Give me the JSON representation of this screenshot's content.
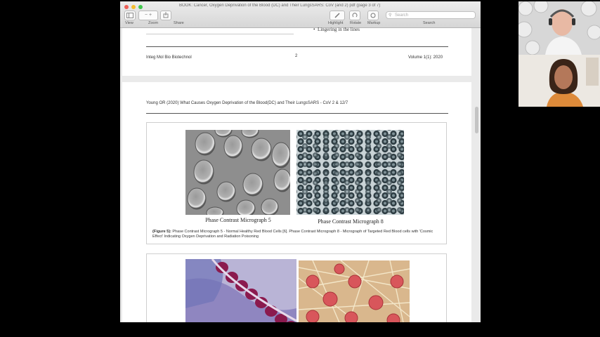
{
  "window": {
    "title": "BOOK: Cancer, Oxygen Deprivation of the Blood (DC) and Their LungsSARS: CoV (and 2) pdf (page 3 of 7)",
    "toolbar_left_labels": [
      "View",
      "Zoom",
      "Share"
    ],
    "toolbar_right_labels": [
      "Highlight",
      "Rotate",
      "Markup"
    ],
    "search_label": "Search",
    "search_placeholder": "Search"
  },
  "page1": {
    "list_item": "Lingering in the lines",
    "journal": "Integ Mol Bio Biotechnol",
    "page_number": "2",
    "volume": "Volume 1(1): 2020"
  },
  "page2": {
    "running_header": "Young OR (2020) What Causes Oxygen Deprivation of the Blood(DC) and Their LungsSARS - CoV 2 & 12/7",
    "figure": {
      "micrograph_left_caption": "Phase Contrast Micrograph 5",
      "micrograph_right_caption": "Phase Contrast Micrograph 8",
      "label": "(Figure 5):",
      "caption": "Phase Contrast Micrograph 5 - Normal Healthy Red Blood Cells [6]. Phase Contrast Micrograph 8 - Micrograph of Targeted Red Blood cells with 'Cosmic Effect' Indicating Oxygen Deprivation and Radiation Poisoning"
    }
  },
  "colors": {
    "background": "#000000",
    "toolbar": "#dcdcdc",
    "document": "#ffffff"
  }
}
